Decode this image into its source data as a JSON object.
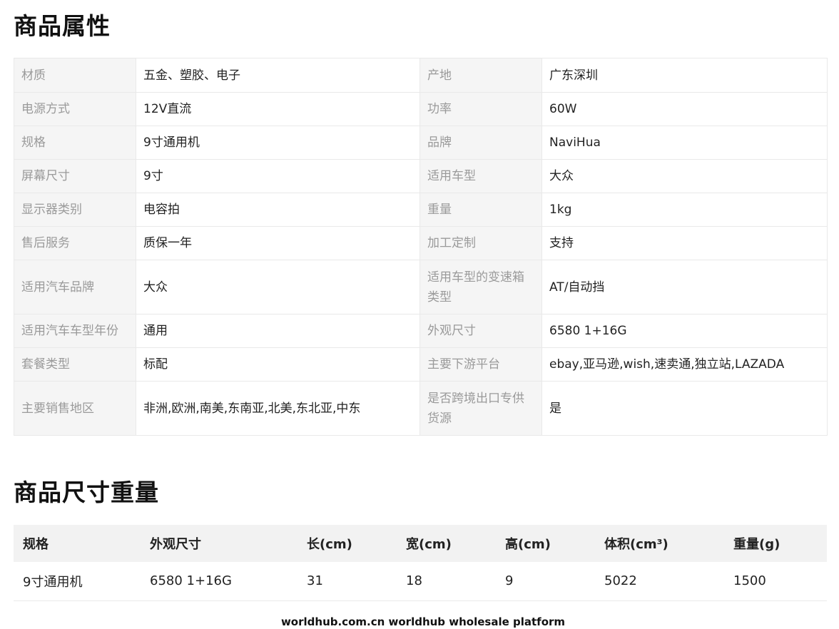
{
  "attributes_section": {
    "title": "商品属性",
    "rows": [
      {
        "k1": "材质",
        "v1": "五金、塑胶、电子",
        "k2": "产地",
        "v2": "广东深圳"
      },
      {
        "k1": "电源方式",
        "v1": "12V直流",
        "k2": "功率",
        "v2": "60W"
      },
      {
        "k1": "规格",
        "v1": "9寸通用机",
        "k2": "品牌",
        "v2": "NaviHua"
      },
      {
        "k1": "屏幕尺寸",
        "v1": "9寸",
        "k2": "适用车型",
        "v2": "大众"
      },
      {
        "k1": "显示器类别",
        "v1": "电容拍",
        "k2": "重量",
        "v2": "1kg"
      },
      {
        "k1": "售后服务",
        "v1": "质保一年",
        "k2": "加工定制",
        "v2": "支持"
      },
      {
        "k1": "适用汽车品牌",
        "v1": "大众",
        "k2": "适用车型的变速箱类型",
        "v2": "AT/自动挡"
      },
      {
        "k1": "适用汽车车型年份",
        "v1": "通用",
        "k2": "外观尺寸",
        "v2": "6580 1+16G"
      },
      {
        "k1": "套餐类型",
        "v1": "标配",
        "k2": "主要下游平台",
        "v2": "ebay,亚马逊,wish,速卖通,独立站,LAZADA"
      },
      {
        "k1": "主要销售地区",
        "v1": "非洲,欧洲,南美,东南亚,北美,东北亚,中东",
        "k2": "是否跨境出口专供货源",
        "v2": "是"
      }
    ]
  },
  "dimensions_section": {
    "title": "商品尺寸重量",
    "headers": [
      "规格",
      "外观尺寸",
      "长(cm)",
      "宽(cm)",
      "高(cm)",
      "体积(cm³)",
      "重量(g)"
    ],
    "rows": [
      [
        "9寸通用机",
        "6580 1+16G",
        "31",
        "18",
        "9",
        "5022",
        "1500"
      ]
    ]
  },
  "footer": {
    "text": "worldhub.com.cn worldhub wholesale platform"
  }
}
